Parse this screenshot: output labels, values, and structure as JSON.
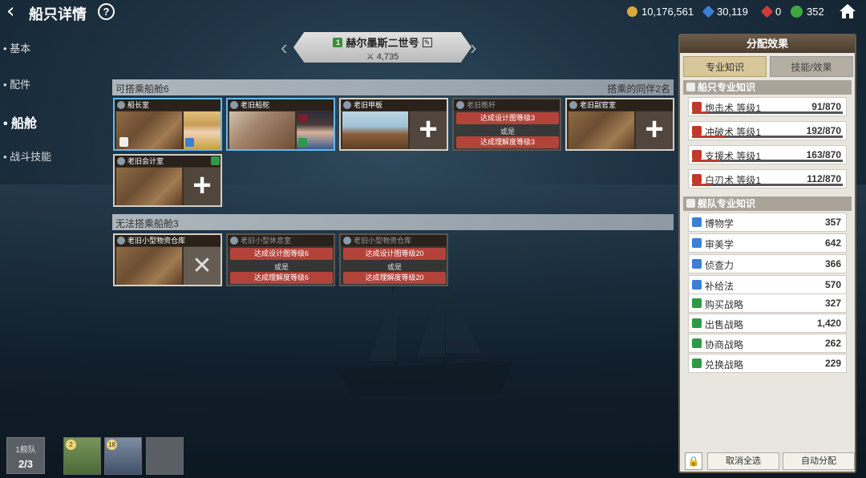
{
  "header": {
    "title": "船只详情",
    "help_label": "?",
    "currencies": [
      {
        "icon": "gold-coin-icon",
        "value": "10,176,561",
        "color": "#d9a93a"
      },
      {
        "icon": "blue-gem-icon",
        "value": "30,119",
        "color": "#3b7fd6"
      },
      {
        "icon": "red-gem-icon",
        "value": "0",
        "color": "#d03a3a"
      },
      {
        "icon": "green-gear-icon",
        "value": "352",
        "color": "#3ea83e"
      }
    ]
  },
  "nav": {
    "items": [
      {
        "label": "基本",
        "active": false
      },
      {
        "label": "配件",
        "active": false
      },
      {
        "label": "船舱",
        "active": true
      },
      {
        "label": "战斗技能",
        "active": false
      }
    ]
  },
  "ship": {
    "level": "1",
    "name": "赫尔墨斯二世号",
    "power": "4,735"
  },
  "boardable": {
    "title": "可搭乘船舱6",
    "crew_note": "搭乘的同伴2名",
    "cabins": [
      {
        "name": "船长室",
        "room": "captain",
        "slot": "portrait-blond",
        "selected": true
      },
      {
        "name": "老旧船舵",
        "room": "wheel",
        "slot": "portrait-dark",
        "selected": true
      },
      {
        "name": "老旧甲板",
        "room": "deck",
        "slot": "add"
      },
      {
        "name": "老旧桅杆",
        "locked": true,
        "req1": "达成设计图等级3",
        "or": "或是",
        "req2": "达成理解度等级3"
      },
      {
        "name": "老旧副官室",
        "room": "captain",
        "slot": "add"
      },
      {
        "name": "老旧会计室",
        "room": "captain",
        "slot": "add"
      }
    ]
  },
  "unboardable": {
    "title": "无法搭乘船舱3",
    "cabins": [
      {
        "name": "老旧小型物资仓库",
        "room": "captain",
        "slot": "x"
      },
      {
        "name": "老旧小型休息室",
        "locked": true,
        "req1": "达成设计图等级6",
        "or": "或是",
        "req2": "达成理解度等级6"
      },
      {
        "name": "老旧小型物资仓库",
        "locked": true,
        "req1": "达成设计图等级20",
        "or": "或是",
        "req2": "达成理解度等级20"
      }
    ]
  },
  "panel": {
    "title": "分配效果",
    "tab_active": "专业知识",
    "tab_inactive": "技能/效果",
    "ship_group": "船只专业知识",
    "ship_skills": [
      {
        "name": "炮击术 等级1",
        "value": "91/870",
        "progress": 0.105
      },
      {
        "name": "冲破术 等级1",
        "value": "192/870",
        "progress": 0.22
      },
      {
        "name": "支援术 等级1",
        "value": "163/870",
        "progress": 0.187
      },
      {
        "name": "白刃术 等级1",
        "value": "112/870",
        "progress": 0.129
      }
    ],
    "fleet_group": "舰队专业知识",
    "fleet_skills": [
      {
        "name": "博物学",
        "value": "357",
        "icon_color": "#3b7fd6"
      },
      {
        "name": "审美学",
        "value": "642",
        "icon_color": "#3b7fd6"
      },
      {
        "name": "侦查力",
        "value": "366",
        "icon_color": "#3b7fd6"
      },
      {
        "name": "补给法",
        "value": "570",
        "icon_color": "#3b7fd6"
      },
      {
        "name": "购买战略",
        "value": "327",
        "icon_color": "#2e9a46"
      },
      {
        "name": "出售战略",
        "value": "1,420",
        "icon_color": "#2e9a46"
      },
      {
        "name": "协商战略",
        "value": "262",
        "icon_color": "#2e9a46"
      },
      {
        "name": "兑换战略",
        "value": "229",
        "icon_color": "#2e9a46"
      }
    ],
    "cancel_label": "取消全选",
    "auto_label": "自动分配"
  },
  "fleet": {
    "label": "1舰队",
    "count": "2/3",
    "ships": [
      {
        "level": "2"
      },
      {
        "level": "18"
      }
    ]
  }
}
